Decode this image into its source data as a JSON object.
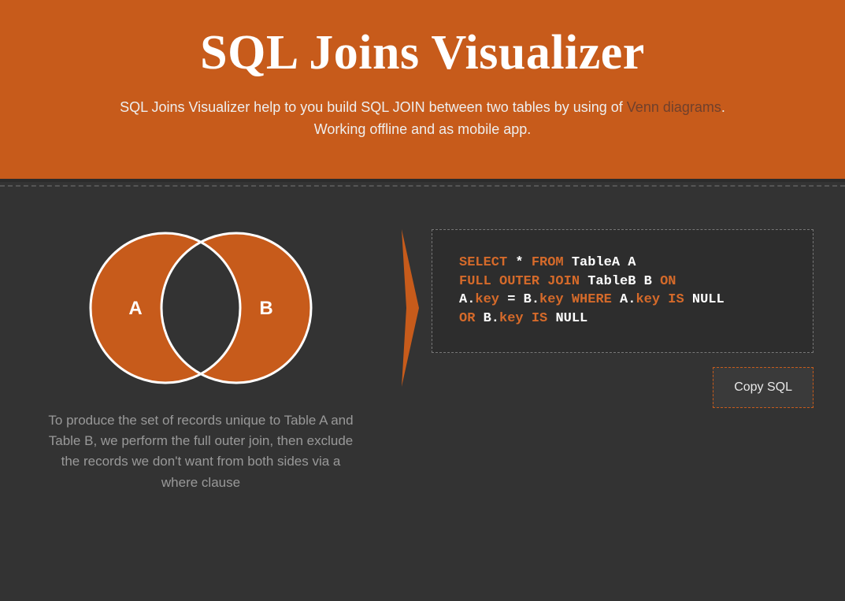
{
  "header": {
    "title": "SQL Joins Visualizer",
    "subtitle_before_link": "SQL Joins Visualizer help to you build SQL JOIN between two tables by using of ",
    "link_text": "Venn diagrams",
    "subtitle_after_link": ".",
    "subtitle_line2": "Working offline and as mobile app."
  },
  "venn": {
    "labelA": "A",
    "labelB": "B"
  },
  "description": "To produce the set of records unique to Table A and Table B, we perform the full outer join, then exclude the records we don't want from both sides via a where clause",
  "sql": {
    "tokens": [
      {
        "t": "SELECT",
        "c": "kw"
      },
      {
        "t": " * ",
        "c": "txt"
      },
      {
        "t": "FROM",
        "c": "kw"
      },
      {
        "t": " TableA A",
        "c": "txt"
      },
      {
        "br": true
      },
      {
        "t": "FULL OUTER JOIN",
        "c": "kw"
      },
      {
        "t": " TableB B ",
        "c": "txt"
      },
      {
        "t": "ON",
        "c": "kw"
      },
      {
        "br": true
      },
      {
        "t": "A.",
        "c": "txt"
      },
      {
        "t": "key",
        "c": "kw"
      },
      {
        "t": " = B.",
        "c": "txt"
      },
      {
        "t": "key",
        "c": "kw"
      },
      {
        "t": " ",
        "c": "txt"
      },
      {
        "t": "WHERE",
        "c": "kw"
      },
      {
        "t": " A.",
        "c": "txt"
      },
      {
        "t": "key",
        "c": "kw"
      },
      {
        "t": " ",
        "c": "txt"
      },
      {
        "t": "IS",
        "c": "kw"
      },
      {
        "t": " ",
        "c": "txt"
      },
      {
        "t": "NULL",
        "c": "txt"
      },
      {
        "br": true
      },
      {
        "t": "OR",
        "c": "kw"
      },
      {
        "t": " B.",
        "c": "txt"
      },
      {
        "t": "key",
        "c": "kw"
      },
      {
        "t": " ",
        "c": "txt"
      },
      {
        "t": "IS",
        "c": "kw"
      },
      {
        "t": " ",
        "c": "txt"
      },
      {
        "t": "NULL",
        "c": "txt"
      }
    ]
  },
  "buttons": {
    "copy_label": "Copy SQL"
  },
  "colors": {
    "accent": "#c75b1b",
    "bg": "#333333"
  }
}
